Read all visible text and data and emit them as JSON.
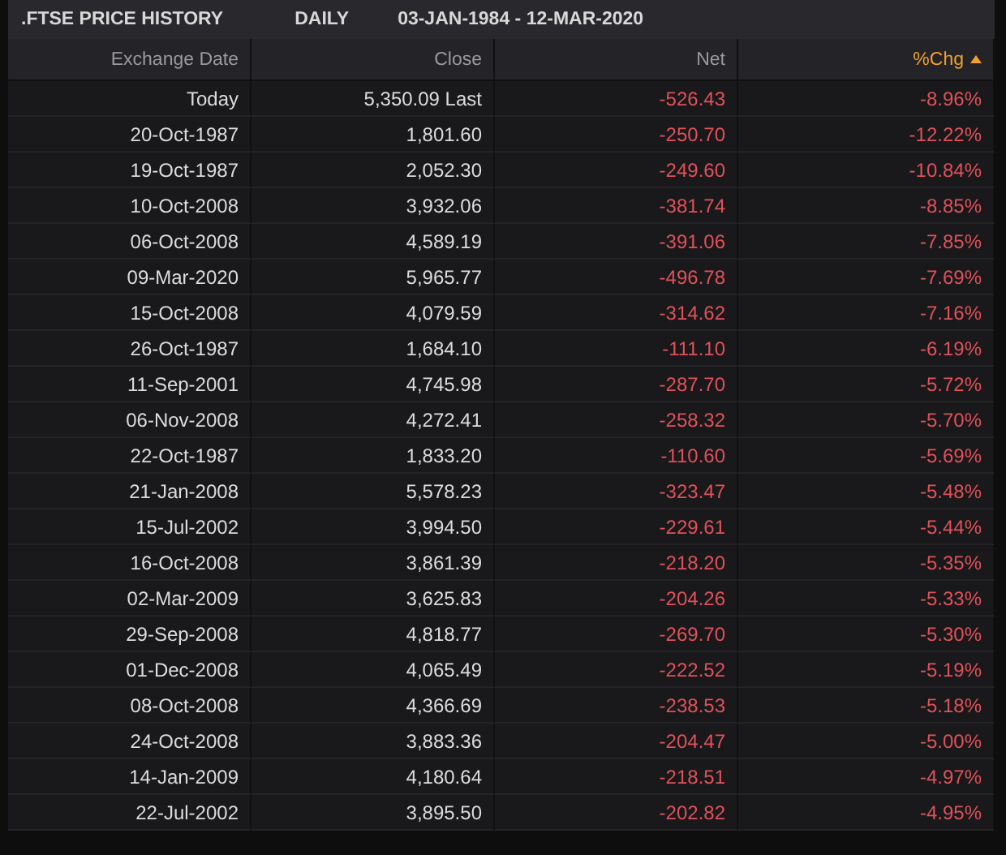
{
  "title_bar": {
    "symbol": ".FTSE PRICE HISTORY",
    "interval": "DAILY",
    "range": "03-JAN-1984 - 12-MAR-2020"
  },
  "table": {
    "columns": [
      {
        "label": "Exchange Date",
        "sorted": false
      },
      {
        "label": "Close",
        "sorted": false
      },
      {
        "label": "Net",
        "sorted": false
      },
      {
        "label": "%Chg",
        "sorted": true
      }
    ],
    "rows": [
      [
        "Today",
        "5,350.09 Last",
        "-526.43",
        "-8.96%"
      ],
      [
        "20-Oct-1987",
        "1,801.60",
        "-250.70",
        "-12.22%"
      ],
      [
        "19-Oct-1987",
        "2,052.30",
        "-249.60",
        "-10.84%"
      ],
      [
        "10-Oct-2008",
        "3,932.06",
        "-381.74",
        "-8.85%"
      ],
      [
        "06-Oct-2008",
        "4,589.19",
        "-391.06",
        "-7.85%"
      ],
      [
        "09-Mar-2020",
        "5,965.77",
        "-496.78",
        "-7.69%"
      ],
      [
        "15-Oct-2008",
        "4,079.59",
        "-314.62",
        "-7.16%"
      ],
      [
        "26-Oct-1987",
        "1,684.10",
        "-111.10",
        "-6.19%"
      ],
      [
        "11-Sep-2001",
        "4,745.98",
        "-287.70",
        "-5.72%"
      ],
      [
        "06-Nov-2008",
        "4,272.41",
        "-258.32",
        "-5.70%"
      ],
      [
        "22-Oct-1987",
        "1,833.20",
        "-110.60",
        "-5.69%"
      ],
      [
        "21-Jan-2008",
        "5,578.23",
        "-323.47",
        "-5.48%"
      ],
      [
        "15-Jul-2002",
        "3,994.50",
        "-229.61",
        "-5.44%"
      ],
      [
        "16-Oct-2008",
        "3,861.39",
        "-218.20",
        "-5.35%"
      ],
      [
        "02-Mar-2009",
        "3,625.83",
        "-204.26",
        "-5.33%"
      ],
      [
        "29-Sep-2008",
        "4,818.77",
        "-269.70",
        "-5.30%"
      ],
      [
        "01-Dec-2008",
        "4,065.49",
        "-222.52",
        "-5.19%"
      ],
      [
        "08-Oct-2008",
        "4,366.69",
        "-238.53",
        "-5.18%"
      ],
      [
        "24-Oct-2008",
        "3,883.36",
        "-204.47",
        "-5.00%"
      ],
      [
        "14-Jan-2009",
        "4,180.64",
        "-218.51",
        "-4.97%"
      ],
      [
        "22-Jul-2002",
        "3,895.50",
        "-202.82",
        "-4.95%"
      ]
    ]
  }
}
